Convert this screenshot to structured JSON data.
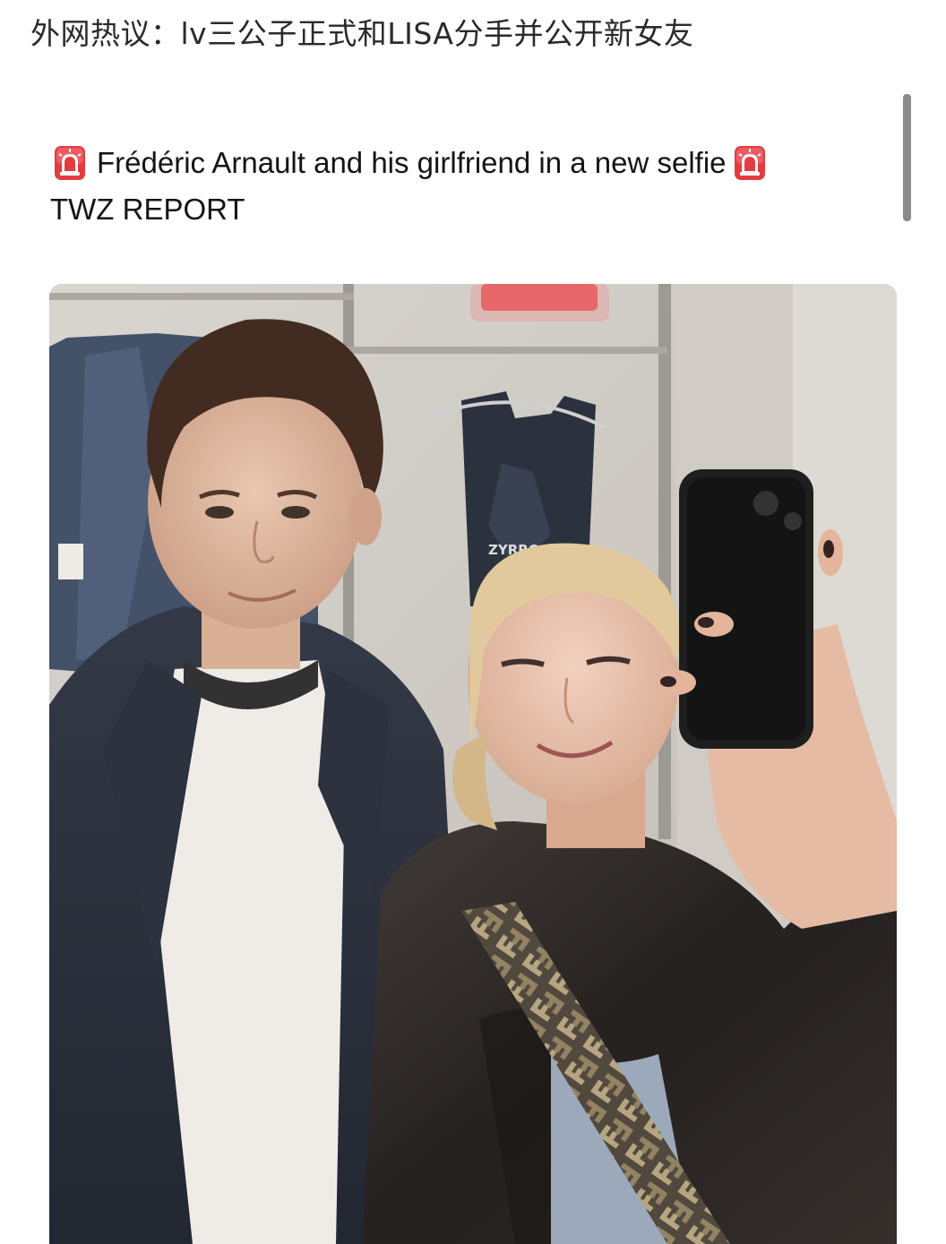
{
  "headline": {
    "text": "外网热议：lv三公子正式和LISA分手并公开新女友"
  },
  "tweet": {
    "line1": "Frédéric Arnault and his girlfriend in a new selfie",
    "line2": "TWZ REPORT",
    "icon_left": "police-car-light-icon",
    "icon_right": "police-car-light-icon"
  },
  "photo": {
    "shirt_print": "ZYRRO"
  },
  "colors": {
    "siren_red": "#e0333a",
    "text": "#141414",
    "scrollbar": "#8a8a8a"
  }
}
